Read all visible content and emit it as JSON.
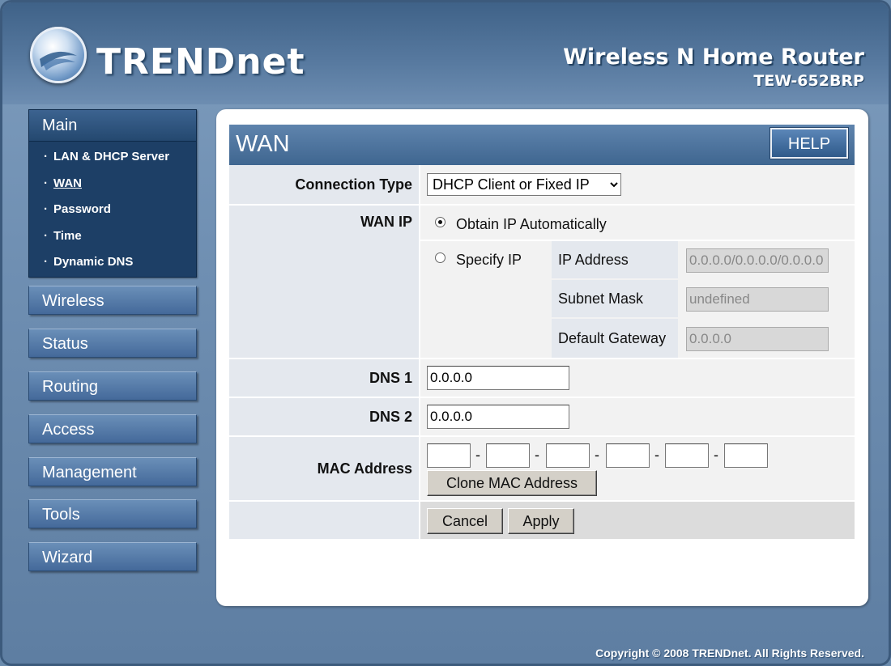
{
  "header": {
    "logo_text": "TRENDnet",
    "product_name": "Wireless N Home Router",
    "product_model": "TEW-652BRP"
  },
  "nav": {
    "main_title": "Main",
    "main_items": [
      {
        "label": "LAN & DHCP Server"
      },
      {
        "label": "WAN",
        "active": true
      },
      {
        "label": "Password"
      },
      {
        "label": "Time"
      },
      {
        "label": "Dynamic DNS"
      }
    ],
    "sections": [
      {
        "label": "Wireless"
      },
      {
        "label": "Status"
      },
      {
        "label": "Routing"
      },
      {
        "label": "Access"
      },
      {
        "label": "Management"
      },
      {
        "label": "Tools"
      },
      {
        "label": "Wizard"
      }
    ]
  },
  "panel": {
    "title": "WAN",
    "help_label": "HELP"
  },
  "form": {
    "connection_type": {
      "label": "Connection Type",
      "selected": "DHCP Client or Fixed IP"
    },
    "wan_ip": {
      "label": "WAN IP",
      "obtain_label": "Obtain IP Automatically",
      "specify_label": "Specify IP",
      "selected": "obtain",
      "ip_address": {
        "label": "IP Address",
        "value": "0.0.0.0/0.0.0.0/0.0.0.0"
      },
      "subnet_mask": {
        "label": "Subnet Mask",
        "value": "undefined"
      },
      "default_gateway": {
        "label": "Default Gateway",
        "value": "0.0.0.0"
      }
    },
    "dns1": {
      "label": "DNS 1",
      "value": "0.0.0.0"
    },
    "dns2": {
      "label": "DNS 2",
      "value": "0.0.0.0"
    },
    "mac_address": {
      "label": "MAC Address",
      "octets": [
        "",
        "",
        "",
        "",
        "",
        ""
      ],
      "separator": "-",
      "clone_label": "Clone MAC Address"
    },
    "cancel_label": "Cancel",
    "apply_label": "Apply"
  },
  "footer": {
    "copyright": "Copyright © 2008 TRENDnet. All Rights Reserved."
  },
  "colors": {
    "brand_blue": "#3f6690",
    "nav_dark": "#1d3f66",
    "label_bg": "#e4e8ee"
  }
}
